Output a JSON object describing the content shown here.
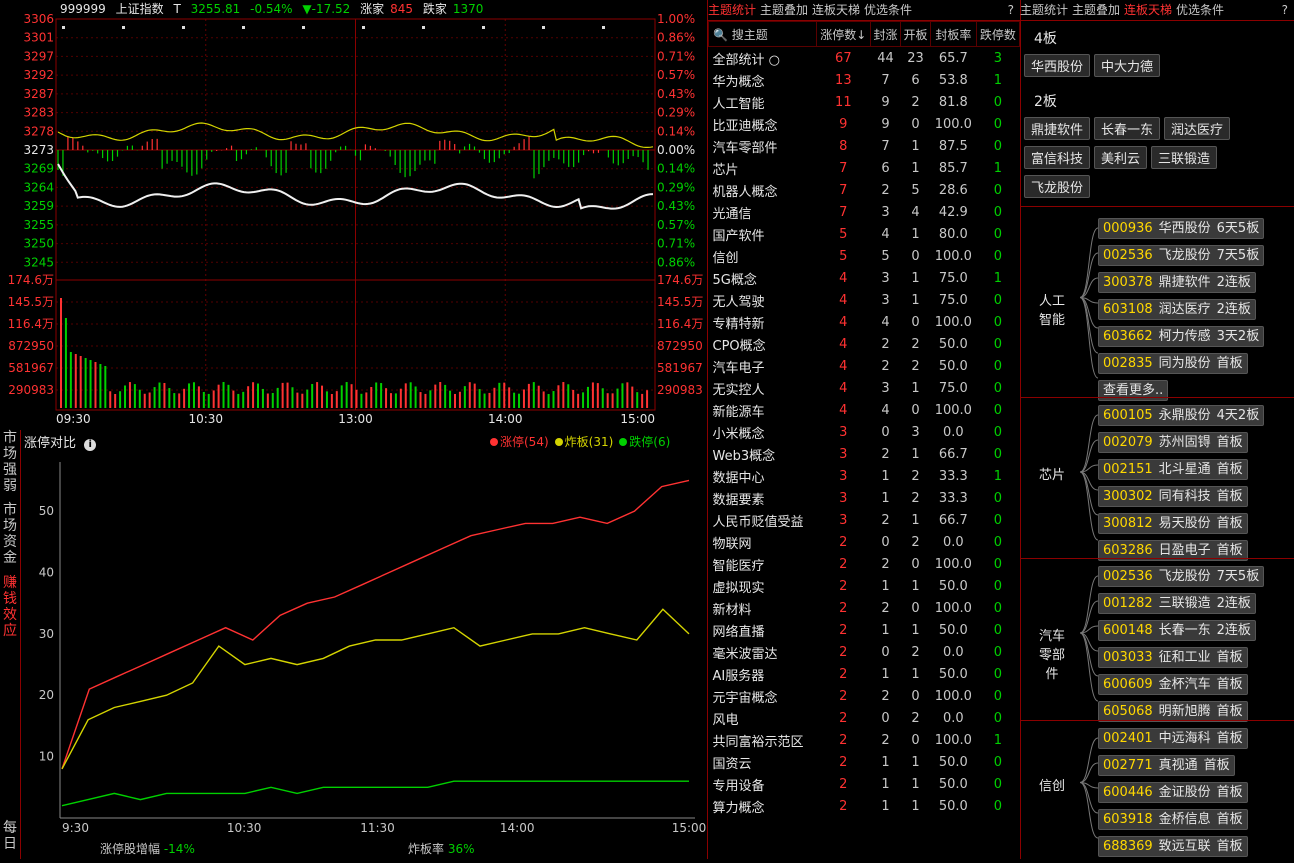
{
  "header": {
    "code": "999999",
    "name": "上证指数",
    "t_label": "T",
    "price": "3255.81",
    "pct": "-0.54%",
    "change": "▼-17.52",
    "up_label": "涨家",
    "up_count": "845",
    "down_label": "跌家",
    "down_count": "1370"
  },
  "price_axis": [
    "3306",
    "3301",
    "3297",
    "3292",
    "3287",
    "3283",
    "3278",
    "3273",
    "3269",
    "3264",
    "3259",
    "3255",
    "3250",
    "3245"
  ],
  "pct_axis": [
    "1.00%",
    "0.86%",
    "0.71%",
    "0.57%",
    "0.43%",
    "0.29%",
    "0.14%",
    "0.00%",
    "0.14%",
    "0.29%",
    "0.43%",
    "0.57%",
    "0.71%",
    "0.86%"
  ],
  "vol_axis": [
    "174.6万",
    "145.5万",
    "116.4万",
    "872950",
    "581967",
    "290983"
  ],
  "time_axis": [
    "09:30",
    "10:30",
    "13:00",
    "14:00",
    "15:00"
  ],
  "lower": {
    "side_tabs": [
      {
        "label": "市场强弱",
        "active": false
      },
      {
        "label": "市场资金",
        "active": false
      },
      {
        "label": "赚钱效应",
        "active": true
      },
      {
        "label": "每日",
        "active": false
      }
    ],
    "title": "涨停对比",
    "info_icon": "info-icon",
    "legend": [
      {
        "name": "涨停(54)",
        "color": "#ff3232"
      },
      {
        "name": "炸板(31)",
        "color": "#d4d400"
      },
      {
        "name": "跌停(6)",
        "color": "#00d000"
      }
    ],
    "footer_left_label": "涨停股增幅",
    "footer_left_value": "-14%",
    "footer_right_label": "炸板率",
    "footer_right_value": "36%"
  },
  "chart_data": {
    "type": "line",
    "x_ticks": [
      "9:30",
      "10:30",
      "11:30",
      "14:00",
      "15:00"
    ],
    "ylim": [
      0,
      58
    ],
    "y_ticks": [
      10,
      20,
      30,
      40,
      50
    ],
    "series": [
      {
        "name": "涨停(54)",
        "color": "#ff3232",
        "values": [
          8,
          21,
          23,
          25,
          27,
          29,
          31,
          29,
          33,
          35,
          36,
          38,
          40,
          42,
          44,
          46,
          47,
          48,
          48,
          49,
          48,
          50,
          54,
          55
        ]
      },
      {
        "name": "炸板(31)",
        "color": "#d4d400",
        "values": [
          8,
          16,
          18,
          19,
          20,
          22,
          28,
          25,
          26,
          25,
          26,
          28,
          29,
          29,
          30,
          31,
          28,
          29,
          30,
          30,
          31,
          30,
          29,
          34,
          30
        ]
      },
      {
        "name": "跌停(6)",
        "color": "#00d000",
        "values": [
          2,
          3,
          4,
          3,
          4,
          4,
          4,
          4,
          5,
          4,
          5,
          5,
          5,
          5,
          5,
          6,
          6,
          6,
          6,
          6,
          6,
          6,
          6,
          6,
          6
        ]
      }
    ]
  },
  "mid": {
    "tabs": [
      {
        "label": "主题统计",
        "active": true
      },
      {
        "label": "主题叠加",
        "active": false
      },
      {
        "label": "连板天梯",
        "active": false
      },
      {
        "label": "优选条件",
        "active": false
      }
    ],
    "help": "?",
    "search_label": "搜主题",
    "columns": [
      "涨停数↓",
      "封涨",
      "开板",
      "封板率",
      "跌停数"
    ],
    "rows": [
      [
        "全部统计 ○",
        "67",
        "44",
        "23",
        "65.7",
        "3"
      ],
      [
        "华为概念",
        "13",
        "7",
        "6",
        "53.8",
        "1"
      ],
      [
        "人工智能",
        "11",
        "9",
        "2",
        "81.8",
        "0"
      ],
      [
        "比亚迪概念",
        "9",
        "9",
        "0",
        "100.0",
        "0"
      ],
      [
        "汽车零部件",
        "8",
        "7",
        "1",
        "87.5",
        "0"
      ],
      [
        "芯片",
        "7",
        "6",
        "1",
        "85.7",
        "1"
      ],
      [
        "机器人概念",
        "7",
        "2",
        "5",
        "28.6",
        "0"
      ],
      [
        "光通信",
        "7",
        "3",
        "4",
        "42.9",
        "0"
      ],
      [
        "国产软件",
        "5",
        "4",
        "1",
        "80.0",
        "0"
      ],
      [
        "信创",
        "5",
        "5",
        "0",
        "100.0",
        "0"
      ],
      [
        "5G概念",
        "4",
        "3",
        "1",
        "75.0",
        "1"
      ],
      [
        "无人驾驶",
        "4",
        "3",
        "1",
        "75.0",
        "0"
      ],
      [
        "专精特新",
        "4",
        "4",
        "0",
        "100.0",
        "0"
      ],
      [
        "CPO概念",
        "4",
        "2",
        "2",
        "50.0",
        "0"
      ],
      [
        "汽车电子",
        "4",
        "2",
        "2",
        "50.0",
        "0"
      ],
      [
        "无实控人",
        "4",
        "3",
        "1",
        "75.0",
        "0"
      ],
      [
        "新能源车",
        "4",
        "4",
        "0",
        "100.0",
        "0"
      ],
      [
        "小米概念",
        "3",
        "0",
        "3",
        "0.0",
        "0"
      ],
      [
        "Web3概念",
        "3",
        "2",
        "1",
        "66.7",
        "0"
      ],
      [
        "数据中心",
        "3",
        "1",
        "2",
        "33.3",
        "1"
      ],
      [
        "数据要素",
        "3",
        "1",
        "2",
        "33.3",
        "0"
      ],
      [
        "人民币贬值受益",
        "3",
        "2",
        "1",
        "66.7",
        "0"
      ],
      [
        "物联网",
        "2",
        "0",
        "2",
        "0.0",
        "0"
      ],
      [
        "智能医疗",
        "2",
        "2",
        "0",
        "100.0",
        "0"
      ],
      [
        "虚拟现实",
        "2",
        "1",
        "1",
        "50.0",
        "0"
      ],
      [
        "新材料",
        "2",
        "2",
        "0",
        "100.0",
        "0"
      ],
      [
        "网络直播",
        "2",
        "1",
        "1",
        "50.0",
        "0"
      ],
      [
        "毫米波雷达",
        "2",
        "0",
        "2",
        "0.0",
        "0"
      ],
      [
        "AI服务器",
        "2",
        "1",
        "1",
        "50.0",
        "0"
      ],
      [
        "元宇宙概念",
        "2",
        "2",
        "0",
        "100.0",
        "0"
      ],
      [
        "风电",
        "2",
        "0",
        "2",
        "0.0",
        "0"
      ],
      [
        "共同富裕示范区",
        "2",
        "2",
        "0",
        "100.0",
        "1"
      ],
      [
        "国资云",
        "2",
        "1",
        "1",
        "50.0",
        "0"
      ],
      [
        "专用设备",
        "2",
        "1",
        "1",
        "50.0",
        "0"
      ],
      [
        "算力概念",
        "2",
        "1",
        "1",
        "50.0",
        "0"
      ]
    ]
  },
  "right": {
    "tabs": [
      {
        "label": "主题统计",
        "active": false
      },
      {
        "label": "主题叠加",
        "active": false
      },
      {
        "label": "连板天梯",
        "active": true
      },
      {
        "label": "优选条件",
        "active": false
      }
    ],
    "help": "?",
    "boards": [
      {
        "title": "4板",
        "stocks": [
          "华西股份",
          "中大力德"
        ]
      },
      {
        "title": "2板",
        "stocks": [
          "鼎捷软件",
          "长春一东",
          "润达医疗",
          "富信科技",
          "美利云",
          "三联锻造",
          "飞龙股份"
        ]
      }
    ],
    "groups": [
      {
        "label": "人工智能",
        "items": [
          {
            "code": "000936",
            "name": "华西股份",
            "tag": "6天5板"
          },
          {
            "code": "002536",
            "name": "飞龙股份",
            "tag": "7天5板"
          },
          {
            "code": "300378",
            "name": "鼎捷软件",
            "tag": "2连板"
          },
          {
            "code": "603108",
            "name": "润达医疗",
            "tag": "2连板"
          },
          {
            "code": "603662",
            "name": "柯力传感",
            "tag": "3天2板"
          },
          {
            "code": "002835",
            "name": "同为股份",
            "tag": "首板"
          }
        ],
        "more": "查看更多.."
      },
      {
        "label": "芯片",
        "items": [
          {
            "code": "600105",
            "name": "永鼎股份",
            "tag": "4天2板"
          },
          {
            "code": "002079",
            "name": "苏州固锝",
            "tag": "首板"
          },
          {
            "code": "002151",
            "name": "北斗星通",
            "tag": "首板"
          },
          {
            "code": "300302",
            "name": "同有科技",
            "tag": "首板"
          },
          {
            "code": "300812",
            "name": "易天股份",
            "tag": "首板"
          },
          {
            "code": "603286",
            "name": "日盈电子",
            "tag": "首板"
          }
        ]
      },
      {
        "label": "汽车零部件",
        "items": [
          {
            "code": "002536",
            "name": "飞龙股份",
            "tag": "7天5板"
          },
          {
            "code": "001282",
            "name": "三联锻造",
            "tag": "2连板"
          },
          {
            "code": "600148",
            "name": "长春一东",
            "tag": "2连板"
          },
          {
            "code": "003033",
            "name": "征和工业",
            "tag": "首板"
          },
          {
            "code": "600609",
            "name": "金杯汽车",
            "tag": "首板"
          },
          {
            "code": "605068",
            "name": "明新旭腾",
            "tag": "首板"
          }
        ]
      },
      {
        "label": "信创",
        "items": [
          {
            "code": "002401",
            "name": "中远海科",
            "tag": "首板"
          },
          {
            "code": "002771",
            "name": "真视通",
            "tag": "首板"
          },
          {
            "code": "600446",
            "name": "金证股份",
            "tag": "首板"
          },
          {
            "code": "603918",
            "name": "金桥信息",
            "tag": "首板"
          },
          {
            "code": "688369",
            "name": "致远互联",
            "tag": "首板"
          }
        ]
      }
    ]
  }
}
